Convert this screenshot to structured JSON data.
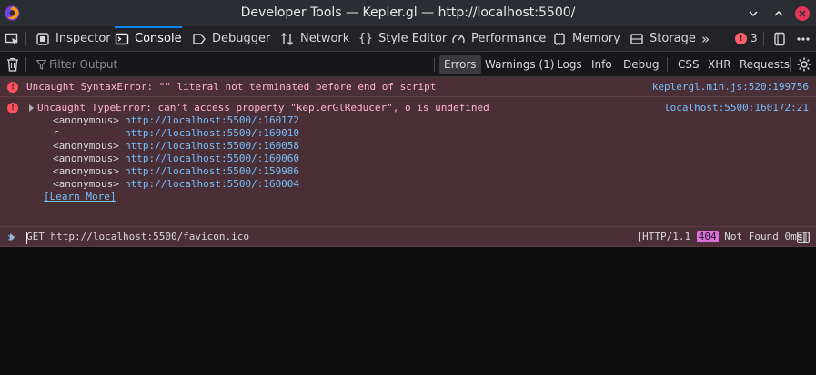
{
  "window": {
    "title": "Developer Tools — Kepler.gl — http://localhost:5500/"
  },
  "toolbar": {
    "tabs": [
      {
        "label": "Inspector",
        "icon": "inspector-icon"
      },
      {
        "label": "Console",
        "icon": "console-icon",
        "selected": true
      },
      {
        "label": "Debugger",
        "icon": "debugger-icon"
      },
      {
        "label": "Network",
        "icon": "network-icon"
      },
      {
        "label": "Style Editor",
        "icon": "style-editor-icon"
      },
      {
        "label": "Performance",
        "icon": "performance-icon"
      },
      {
        "label": "Memory",
        "icon": "memory-icon"
      },
      {
        "label": "Storage",
        "icon": "storage-icon"
      }
    ],
    "error_count": "3"
  },
  "filter": {
    "placeholder": "Filter Output",
    "levels": [
      "Errors",
      "Warnings (1)",
      "Logs",
      "Info",
      "Debug"
    ],
    "active_level": "Errors",
    "types": [
      "CSS",
      "XHR",
      "Requests"
    ]
  },
  "messages": {
    "syntax_error": {
      "text": "Uncaught SyntaxError: \"\" literal not terminated before end of script",
      "source": "keplergl.min.js:520:199756"
    },
    "type_error": {
      "text": "Uncaught TypeError: can't access property \"keplerGlReducer\", o is undefined",
      "source": "localhost:5500:160172:21",
      "stack": [
        {
          "fn": "<anonymous>",
          "loc": "http://localhost:5500/:160172"
        },
        {
          "fn": "r",
          "loc": "http://localhost:5500/:160010"
        },
        {
          "fn": "<anonymous>",
          "loc": "http://localhost:5500/:160058"
        },
        {
          "fn": "<anonymous>",
          "loc": "http://localhost:5500/:160060"
        },
        {
          "fn": "<anonymous>",
          "loc": "http://localhost:5500/:159986"
        },
        {
          "fn": "<anonymous>",
          "loc": "http://localhost:5500/:160004"
        }
      ],
      "learn_more": "[Learn More]"
    },
    "network": {
      "text": "GET http://localhost:5500/favicon.ico",
      "protocol": "[HTTP/1.1",
      "status": "404",
      "status_text": "Not Found 0ms]"
    }
  },
  "colors": {
    "accent": "#0a84ff",
    "error_bg": "#4b2f36",
    "link": "#75bfff",
    "status_404": "#e06ee0"
  }
}
